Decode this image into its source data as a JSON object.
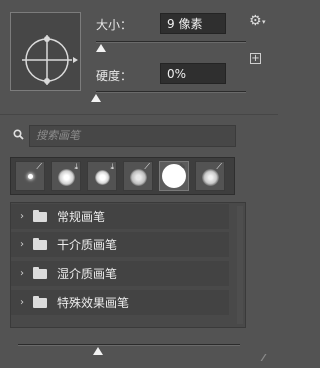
{
  "preview": {
    "icon": "brush-tip-angle-preview"
  },
  "size": {
    "label": "大小：",
    "value": "9 像素",
    "slider_percent": 8
  },
  "hardness": {
    "label": "硬度：",
    "value": "0%",
    "slider_percent": 0
  },
  "header": {
    "gear_icon": "⚙",
    "caret": "▾",
    "new_preset_icon": "+"
  },
  "search": {
    "placeholder": "搜索画笔",
    "value": ""
  },
  "brushes": [
    {
      "name": "brush-1",
      "badge": "⟋"
    },
    {
      "name": "brush-2",
      "badge": "⤓"
    },
    {
      "name": "brush-3",
      "badge": "⤓"
    },
    {
      "name": "brush-4",
      "badge": "⟋"
    },
    {
      "name": "brush-5",
      "badge": "✎",
      "selected": true
    },
    {
      "name": "brush-6",
      "badge": "⟋"
    }
  ],
  "groups": [
    {
      "label": "常规画笔"
    },
    {
      "label": "干介质画笔"
    },
    {
      "label": "湿介质画笔"
    },
    {
      "label": "特殊效果画笔"
    }
  ],
  "zoom": {
    "slider_percent": 36
  },
  "colors": {
    "panel_bg": "#535353",
    "field_bg": "#2f2f2f",
    "thumb": "#f2f2f2"
  }
}
